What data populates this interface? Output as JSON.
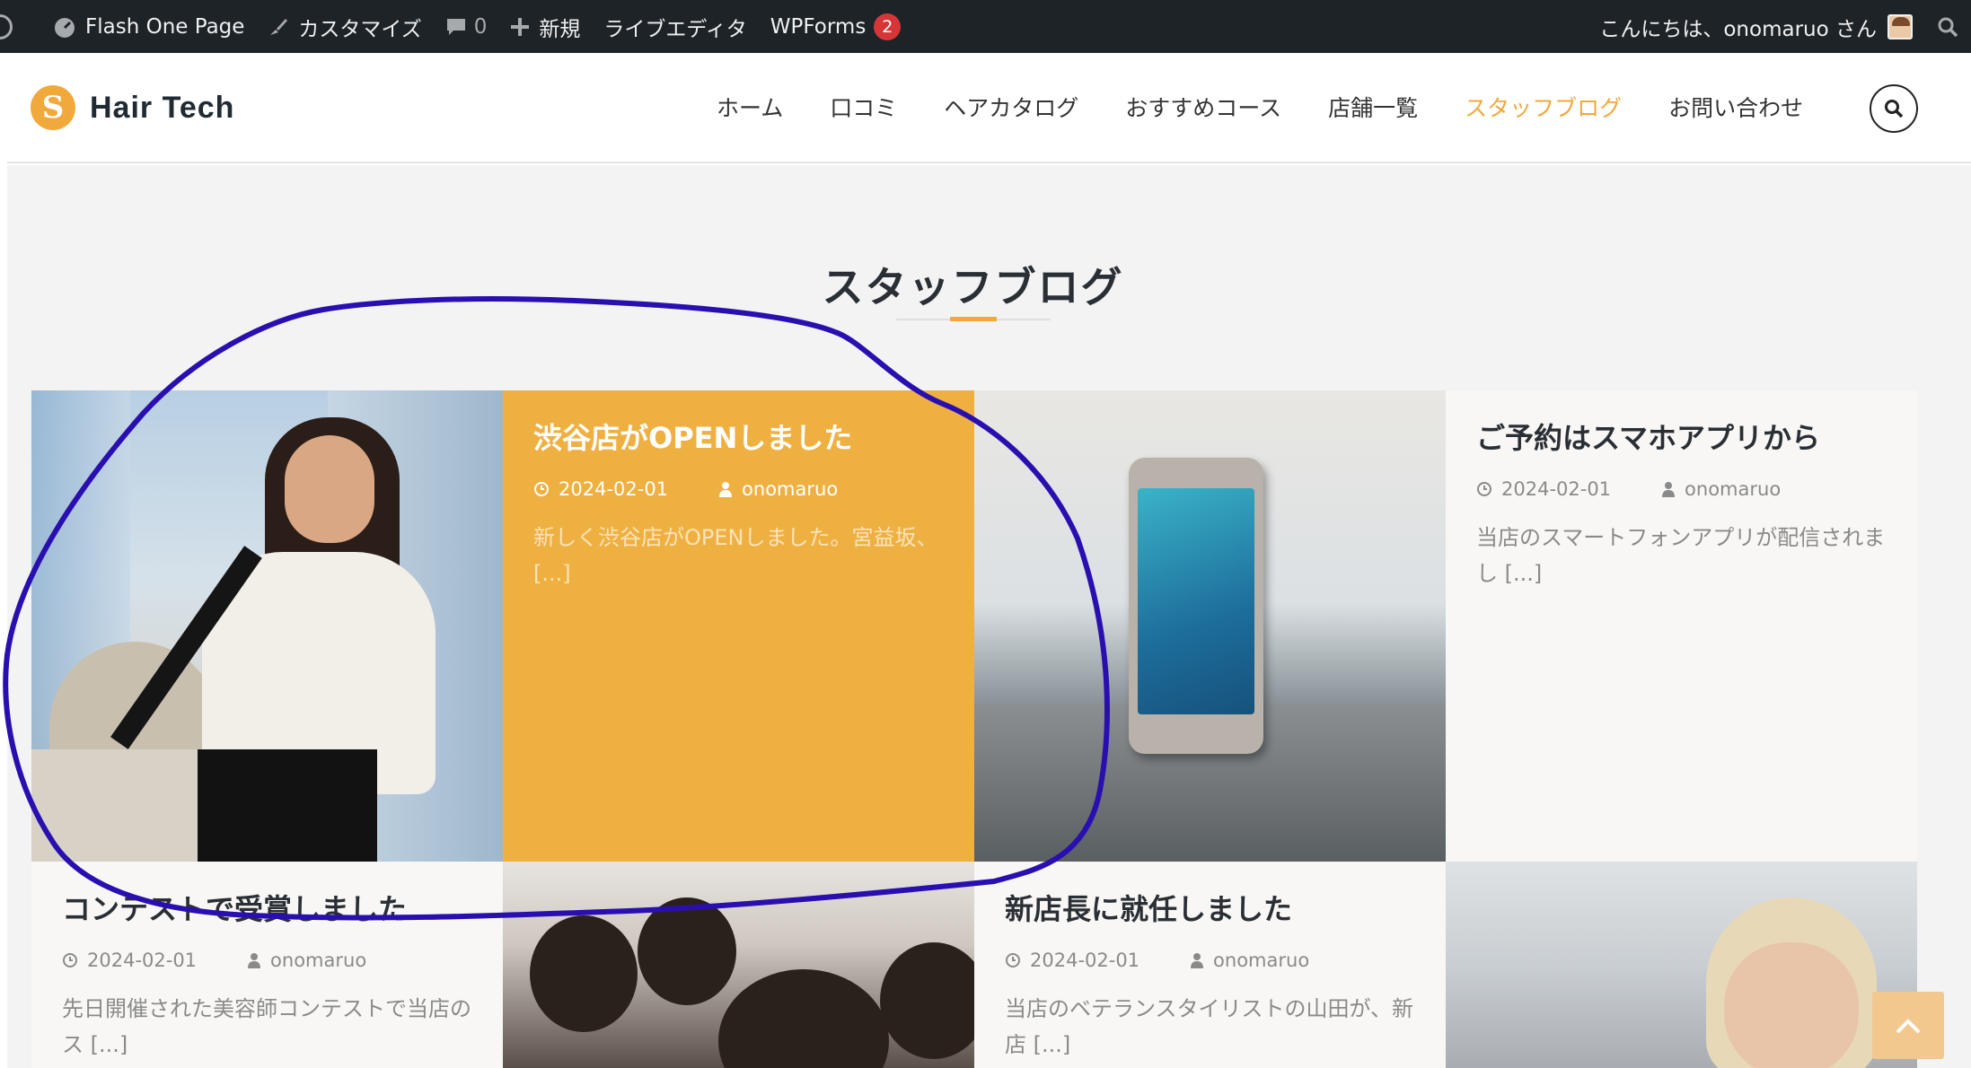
{
  "adminbar": {
    "site_name": "Flash One Page",
    "customize": "カスタマイズ",
    "comments_count": "0",
    "new": "新規",
    "live_editor": "ライブエディタ",
    "wpforms": "WPForms",
    "wpforms_count": "2",
    "greeting": "こんにちは、onomaruo さん"
  },
  "site": {
    "logo_letter": "S",
    "name": "Hair Tech"
  },
  "nav": {
    "items": [
      "ホーム",
      "口コミ",
      "ヘアカタログ",
      "おすすめコース",
      "店舗一覧",
      "スタッフブログ",
      "お問い合わせ"
    ],
    "active": "スタッフブログ"
  },
  "section": {
    "title": "スタッフブログ"
  },
  "posts": [
    {
      "title": "渋谷店がOPENしました",
      "date": "2024-02-01",
      "author": "onomaruo",
      "excerpt_line1": "新しく渋谷店がOPENしました。宮益坂、",
      "excerpt_line2": "[...]"
    },
    {
      "title": "ご予約はスマホアプリから",
      "date": "2024-02-01",
      "author": "onomaruo",
      "excerpt_line1": "当店のスマートフォンアプリが配信されま",
      "excerpt_line2": "し [...]"
    },
    {
      "title": "コンテストで受賞しました",
      "date": "2024-02-01",
      "author": "onomaruo",
      "excerpt_line1": "先日開催された美容師コンテストで当店の",
      "excerpt_line2": "ス [...]"
    },
    {
      "title": "新店長に就任しました",
      "date": "2024-02-01",
      "author": "onomaruo",
      "excerpt_line1": "当店のベテランスタイリストの山田が、新",
      "excerpt_line2": "店 [...]"
    }
  ],
  "colors": {
    "accent": "#efb042",
    "adminbar": "#1d2327",
    "annotation_stroke": "#2a0fb0"
  }
}
